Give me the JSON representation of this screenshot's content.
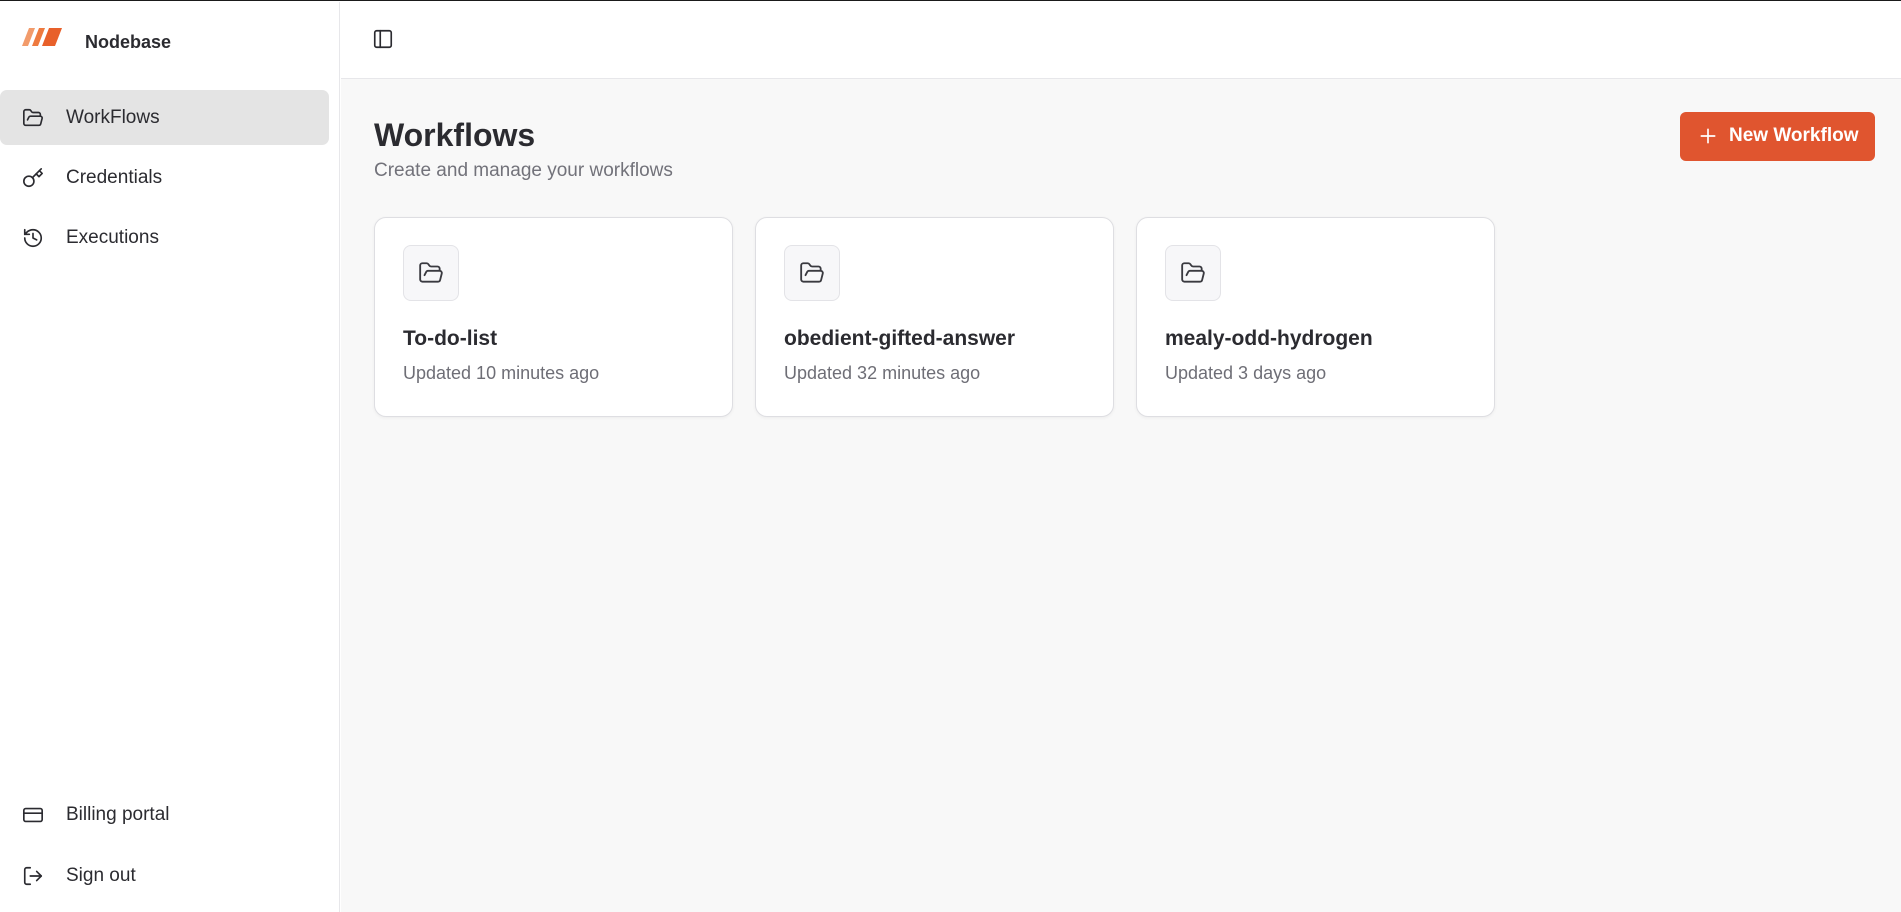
{
  "brand": {
    "name": "Nodebase",
    "accent": "#e0552f"
  },
  "sidebar": {
    "items": [
      {
        "label": "WorkFlows",
        "icon": "folder-open-icon",
        "active": true
      },
      {
        "label": "Credentials",
        "icon": "key-icon",
        "active": false
      },
      {
        "label": "Executions",
        "icon": "history-icon",
        "active": false
      }
    ],
    "footer": [
      {
        "label": "Billing portal",
        "icon": "credit-card-icon"
      },
      {
        "label": "Sign out",
        "icon": "log-out-icon"
      }
    ]
  },
  "header": {
    "toggle_icon": "panel-left-icon"
  },
  "main": {
    "title": "Workflows",
    "subtitle": "Create and manage your workflows",
    "new_button_label": "New Workflow",
    "workflows": [
      {
        "name": "To-do-list",
        "updated": "Updated 10 minutes ago"
      },
      {
        "name": "obedient-gifted-answer",
        "updated": "Updated 32 minutes ago"
      },
      {
        "name": "mealy-odd-hydrogen",
        "updated": "Updated 3 days ago"
      }
    ]
  }
}
